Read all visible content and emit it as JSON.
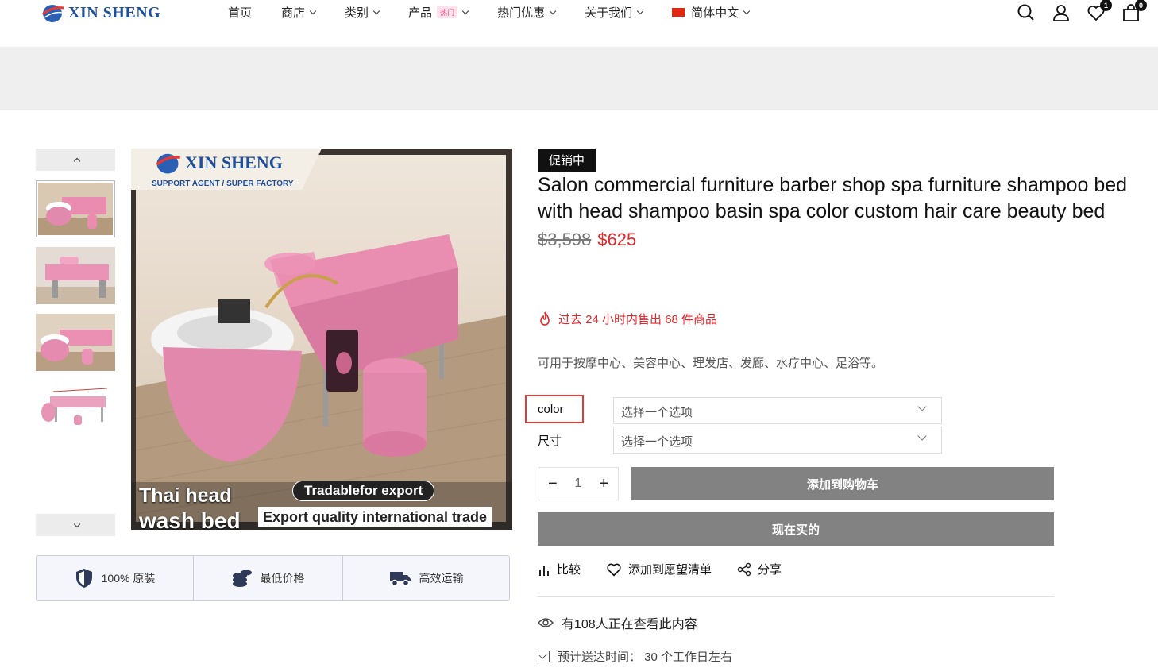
{
  "header": {
    "logo_text": "XIN SHENG",
    "nav": [
      {
        "label": "首页",
        "dropdown": false
      },
      {
        "label": "商店",
        "dropdown": true
      },
      {
        "label": "类别",
        "dropdown": true
      },
      {
        "label": "产品",
        "dropdown": true,
        "badge": "热门"
      },
      {
        "label": "热门优惠",
        "dropdown": true
      },
      {
        "label": "关于我们",
        "dropdown": true
      },
      {
        "label": "简体中文",
        "dropdown": true
      }
    ],
    "wishlist_count": "1",
    "cart_count": "0"
  },
  "gallery": {
    "main_image_texts": {
      "brand": "XIN SHENG",
      "tagline": "SUPPORT AGENT / SUPER FACTORY",
      "caption_left_1": "Thai head",
      "caption_left_2": "wash bed",
      "caption_pill": "Tradablefor export",
      "caption_right": "Export quality international trade"
    }
  },
  "badges": [
    {
      "icon": "shield-icon",
      "label": "100% 原装"
    },
    {
      "icon": "coins-icon",
      "label": "最低价格"
    },
    {
      "icon": "truck-icon",
      "label": "高效运输"
    }
  ],
  "product": {
    "sale_tag": "促销中",
    "title": "Salon commercial furniture barber shop spa furniture shampoo bed with head shampoo basin spa color custom hair care beauty bed",
    "old_price": "$3,598",
    "price": "$625",
    "sold_text": "过去 24 小时内售出 68 件商品",
    "description": "可用于按摩中心、美容中心、理发店、发廊、水疗中心、足浴等。",
    "variants": [
      {
        "label": "color",
        "placeholder": "选择一个选项"
      },
      {
        "label": "尺寸",
        "placeholder": "选择一个选项"
      }
    ],
    "quantity": "1",
    "add_to_cart": "添加到购物车",
    "buy_now": "现在买的",
    "actions": {
      "compare": "比较",
      "wishlist": "添加到愿望清单",
      "share": "分享"
    },
    "viewing": "有108人正在查看此内容",
    "delivery": "预计送达时间：  30 个工作日左右"
  },
  "colors": {
    "accent_red": "#e3262a",
    "button_gray": "#828282",
    "highlight": "#e53935"
  }
}
